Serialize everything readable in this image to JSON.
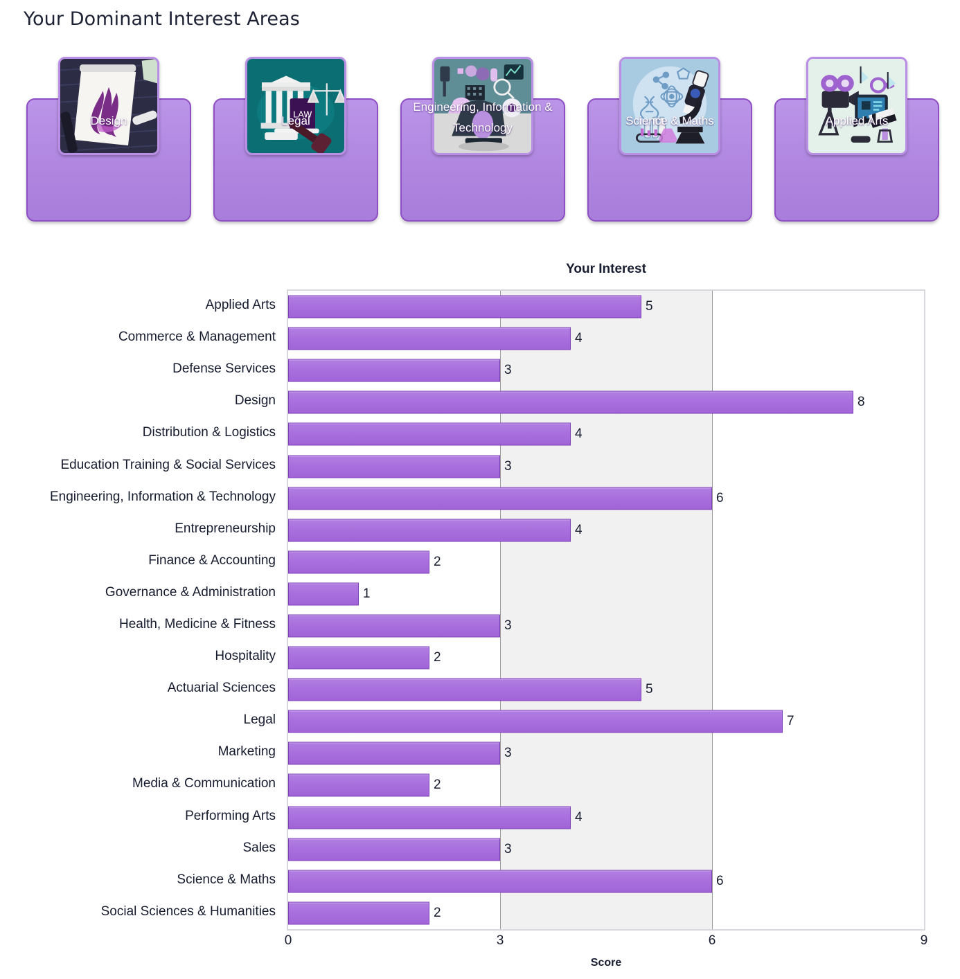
{
  "header": {
    "title": "Your Dominant Interest Areas"
  },
  "cards": [
    {
      "label": "Design",
      "icon": "design-sketchbook-icon"
    },
    {
      "label": "Legal",
      "icon": "legal-courthouse-gavel-icon"
    },
    {
      "label": "Engineering, Information & Technology",
      "icon": "engineering-microscope-tech-icon"
    },
    {
      "label": "Science & Maths",
      "icon": "science-microscope-icon"
    },
    {
      "label": "Applied Arts",
      "icon": "applied-arts-camera-icon"
    }
  ],
  "colors": {
    "card_fill": "#b086e0",
    "card_border": "#8e4fc4",
    "bar_fill": "#a96fdd",
    "bar_border": "#7d3fb5",
    "band_fill": "#f1f1f1",
    "plot_border": "#d8d8dc",
    "text": "#161b2e"
  },
  "chart_data": {
    "type": "bar",
    "orientation": "horizontal",
    "title": "Your Interest",
    "xlabel": "Score",
    "ylabel": "",
    "xlim": [
      0,
      9
    ],
    "xticks": [
      0,
      3,
      6,
      9
    ],
    "grid": true,
    "legend": null,
    "shaded_band": {
      "from": 3,
      "to": 6
    },
    "data_labels": true,
    "categories": [
      "Applied Arts",
      "Commerce & Management",
      "Defense Services",
      "Design",
      "Distribution & Logistics",
      "Education Training & Social Services",
      "Engineering, Information & Technology",
      "Entrepreneurship",
      "Finance & Accounting",
      "Governance & Administration",
      "Health, Medicine & Fitness",
      "Hospitality",
      "Actuarial Sciences",
      "Legal",
      "Marketing",
      "Media & Communication",
      "Performing Arts",
      "Sales",
      "Science & Maths",
      "Social Sciences & Humanities"
    ],
    "values": [
      5,
      4,
      3,
      8,
      4,
      3,
      6,
      4,
      2,
      1,
      3,
      2,
      5,
      7,
      3,
      2,
      4,
      3,
      6,
      2
    ]
  }
}
